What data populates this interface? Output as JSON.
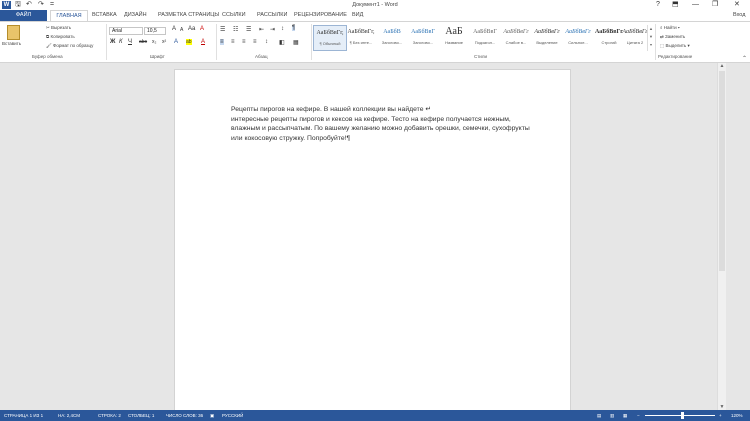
{
  "window": {
    "title": "Документ1 - Word",
    "app_icon": "W",
    "quick_access": [
      {
        "icon": "save-icon",
        "glyph": "🖫"
      },
      {
        "icon": "undo-icon",
        "glyph": "↶"
      },
      {
        "icon": "redo-icon",
        "glyph": "↷"
      },
      {
        "icon": "customize-qat-icon",
        "glyph": "="
      }
    ],
    "controls": {
      "help": "?",
      "ribbon_options": "⬒",
      "minimize": "—",
      "restore": "❐",
      "close": "✕"
    },
    "user": "Вход"
  },
  "tabs": [
    "ФАЙЛ",
    "ГЛАВНАЯ",
    "ВСТАВКА",
    "ДИЗАЙН",
    "РАЗМЕТКА СТРАНИЦЫ",
    "ССЫЛКИ",
    "РАССЫЛКИ",
    "РЕЦЕНЗИРОВАНИЕ",
    "ВИД"
  ],
  "active_tab": "ГЛАВНАЯ",
  "ribbon": {
    "clipboard": {
      "label": "Буфер обмена",
      "paste": "Вставить",
      "cut": "Вырезать",
      "copy": "Копировать",
      "format_painter": "Формат по образцу"
    },
    "font": {
      "label": "Шрифт",
      "font_name": "Arial",
      "font_size": "10,5",
      "bold": "Ж",
      "italic": "К",
      "underline": "Ч",
      "strike": "abc",
      "sub": "x₂",
      "sup": "x²",
      "grow": "A",
      "shrink": "A",
      "case": "Aa",
      "clear": "A",
      "text_effects": "A",
      "highlight": "ab",
      "font_color": "A"
    },
    "paragraph": {
      "label": "Абзац"
    },
    "styles": {
      "label": "Стили",
      "items": [
        {
          "preview": "АаБбВвГг,",
          "name": "¶ Обычный"
        },
        {
          "preview": "АаБбВвГг,",
          "name": "¶ Без инте..."
        },
        {
          "preview": "АаБбВ",
          "name": "Заголово..."
        },
        {
          "preview": "АаБбВвГ",
          "name": "Заголово..."
        },
        {
          "preview": "АаБ",
          "name": "Название"
        },
        {
          "preview": "АаБбВвГ",
          "name": "Подзагол..."
        },
        {
          "preview": "АаБбВвГг",
          "name": "Слабое в..."
        },
        {
          "preview": "АаБбВвГг",
          "name": "Выделение"
        },
        {
          "preview": "АаБбВвГг",
          "name": "Сильное..."
        },
        {
          "preview": "АаБбВвГг",
          "name": "Строгий"
        },
        {
          "preview": "АаБбВвГг",
          "name": "Цитата 2"
        }
      ]
    },
    "editing": {
      "label": "Редактирование",
      "find": "Найти",
      "replace": "Заменить",
      "select": "Выделить"
    }
  },
  "document": {
    "lines": [
      "Рецепты пирогов на кефире. В нашей коллекции вы найдете ↵",
      "интересные рецепты пирогов и кексов на кефире. Тесто на кефире получается нежным,",
      "влажным и рассыпчатым. По вашему желанию можно добавить орешки, семечки, сухофрукты",
      "или кокосовую стружку. Попробуйте!¶"
    ]
  },
  "status": {
    "page": "СТРАНИЦА 1 ИЗ 1",
    "position": "НА: 2,4СМ",
    "line": "СТРОКА: 2",
    "column": "СТОЛБЕЦ: 1",
    "words": "ЧИСЛО СЛОВ: 36",
    "language": "РУССКИЙ",
    "zoom": "120%"
  },
  "colors": {
    "accent": "#2b579a",
    "highlight": "#ffff00",
    "font_color": "#c00000"
  }
}
